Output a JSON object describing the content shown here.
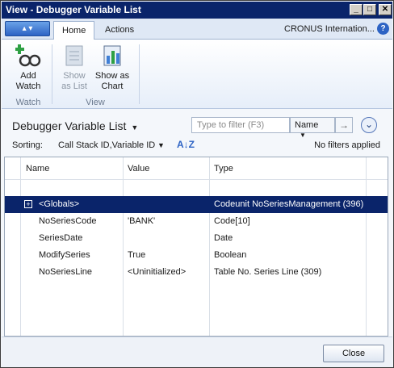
{
  "window": {
    "title": "View - Debugger Variable List",
    "min_label": "_",
    "max_label": "□",
    "close_label": "✕"
  },
  "ribbon": {
    "tabs": [
      "Home",
      "Actions"
    ],
    "company": "CRONUS Internation...",
    "help_glyph": "?",
    "groups": {
      "watch": {
        "label": "Watch",
        "add_watch": "Add Watch"
      },
      "view": {
        "label": "View",
        "show_as_list": "Show as List",
        "show_as_chart": "Show as Chart"
      }
    }
  },
  "page": {
    "title": "Debugger Variable List",
    "filter_placeholder": "Type to filter (F3)",
    "filter_field": "Name",
    "sorting_label": "Sorting:",
    "sorting_value": "Call Stack ID,Variable ID",
    "filters_text": "No filters applied"
  },
  "grid": {
    "columns": [
      "Name",
      "Value",
      "Type"
    ],
    "rows": [
      {
        "name": "<Globals>",
        "value": "",
        "type": "Codeunit NoSeriesManagement (396)",
        "selected": true,
        "expandable": true
      },
      {
        "name": "NoSeriesCode",
        "value": "'BANK'",
        "type": "Code[10]"
      },
      {
        "name": "SeriesDate",
        "value": "",
        "type": "Date"
      },
      {
        "name": "ModifySeries",
        "value": "True",
        "type": "Boolean"
      },
      {
        "name": "NoSeriesLine",
        "value": "<Uninitialized>",
        "type": "Table No. Series Line (309)"
      }
    ]
  },
  "footer": {
    "close_label": "Close"
  },
  "colors": {
    "selection": "#0a246a",
    "titlebar": "#0a246a"
  },
  "icons": [
    "add-watch-icon",
    "show-as-list-icon",
    "show-as-chart-icon",
    "help-icon",
    "collapse-icon",
    "expand-icon",
    "sort-az-icon"
  ]
}
